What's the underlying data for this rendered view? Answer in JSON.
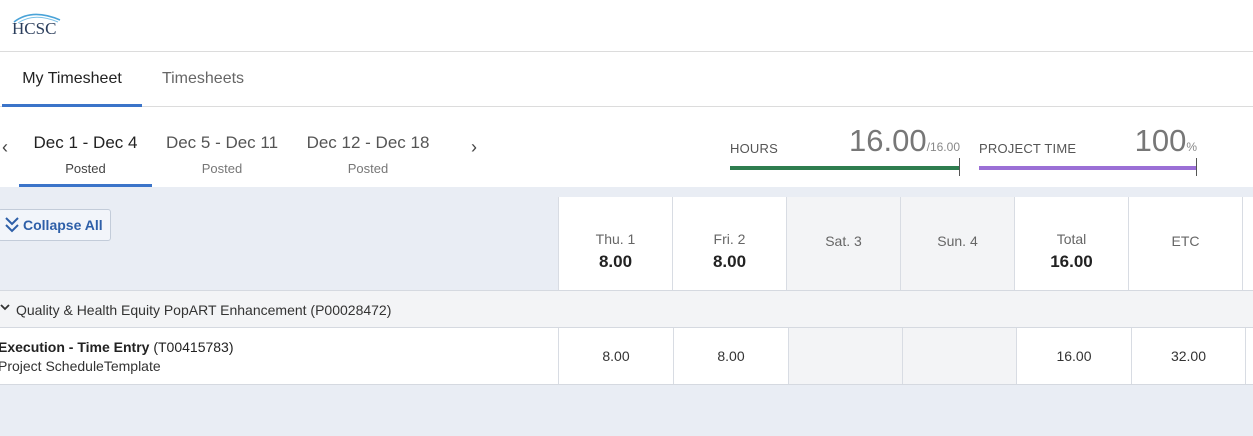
{
  "header": {
    "logo_text": "HCSC"
  },
  "main_tabs": [
    {
      "label": "My Timesheet"
    },
    {
      "label": "Timesheets"
    }
  ],
  "weeks": [
    {
      "range": "Dec 1 - Dec 4",
      "status": "Posted"
    },
    {
      "range": "Dec 5 - Dec 11",
      "status": "Posted"
    },
    {
      "range": "Dec 12 - Dec 18",
      "status": "Posted"
    }
  ],
  "metrics": {
    "hours": {
      "label": "HOURS",
      "value": "16.00",
      "suffix": "/16.00",
      "progress": 1.0,
      "color": "#2e7d4f"
    },
    "project_time": {
      "label": "PROJECT TIME",
      "value": "100",
      "suffix": "%",
      "progress": 1.0,
      "color": "#9b6fd6"
    }
  },
  "grid": {
    "collapse_label": "Collapse All",
    "columns": [
      {
        "label": "Thu. 1",
        "hours": "8.00"
      },
      {
        "label": "Fri. 2",
        "hours": "8.00"
      },
      {
        "label": "Sat. 3",
        "hours": ""
      },
      {
        "label": "Sun. 4",
        "hours": ""
      },
      {
        "label": "Total",
        "hours": "16.00"
      },
      {
        "label": "ETC",
        "hours": ""
      }
    ],
    "project": {
      "name": "Quality & Health Equity PopART Enhancement (P00028472)"
    },
    "task": {
      "name": "Execution - Time Entry",
      "code": "(T00415783)",
      "template": "Project ScheduleTemplate",
      "cells": [
        "8.00",
        "8.00",
        "",
        "",
        "16.00",
        "32.00"
      ]
    }
  }
}
